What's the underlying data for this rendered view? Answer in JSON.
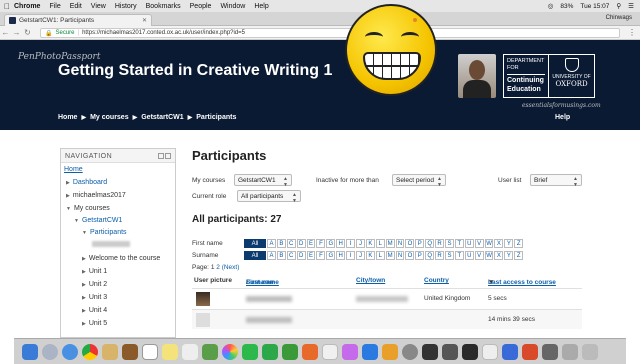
{
  "menubar": {
    "app": "Chrome",
    "items": [
      "File",
      "Edit",
      "View",
      "History",
      "Bookmarks",
      "People",
      "Window",
      "Help"
    ],
    "battery": "83%",
    "clock": "Tue 15:07"
  },
  "browser": {
    "tab_title": "GetstartCW1: Participants",
    "profile": "Chinwags",
    "secure_label": "Secure",
    "url": "https://michaelmas2017.conted.ox.ac.uk/user/index.php?id=5"
  },
  "header": {
    "watermark_top": "PenPhotoPassport",
    "course_title": "Getting Started in Creative Writing 1",
    "dept_logo": [
      "DEPARTMENT FOR",
      "Continuing",
      "Education"
    ],
    "oxford_logo": [
      "UNIVERSITY OF",
      "OXFORD"
    ],
    "watermark_bottom": "essentialsformusings.com",
    "breadcrumb": [
      "Home",
      "My courses",
      "GetstartCW1",
      "Participants"
    ],
    "help": "Help"
  },
  "navigation": {
    "title": "NAVIGATION",
    "home": "Home",
    "dashboard": "Dashboard",
    "michaelmas": "michaelmas2017",
    "my_courses": "My courses",
    "course": "GetstartCW1",
    "participants": "Participants",
    "welcome": "Welcome to the course",
    "units": [
      "Unit 1",
      "Unit 2",
      "Unit 3",
      "Unit 4",
      "Unit 5"
    ]
  },
  "main": {
    "title": "Participants",
    "my_courses_label": "My courses",
    "my_courses_value": "GetstartCW1",
    "inactive_label": "Inactive for more than",
    "inactive_value": "Select period",
    "user_list_label": "User list",
    "user_list_value": "Brief",
    "current_role_label": "Current role",
    "current_role_value": "All participants",
    "all_participants": "All participants: 27",
    "first_name_label": "First name",
    "surname_label": "Surname",
    "all_label": "All",
    "letters": [
      "A",
      "B",
      "C",
      "D",
      "E",
      "F",
      "G",
      "H",
      "I",
      "J",
      "K",
      "L",
      "M",
      "N",
      "O",
      "P",
      "Q",
      "R",
      "S",
      "T",
      "U",
      "V",
      "W",
      "X",
      "Y",
      "Z"
    ],
    "page_prefix": "Page:",
    "page_current": "1",
    "page_2": "2",
    "page_next": "(Next)"
  },
  "table": {
    "col_picture": "User picture",
    "col_first": "First name",
    "col_sep": " / ",
    "col_surname": "Surname",
    "col_city": "City/town",
    "col_country": "Country",
    "col_last": "Last access to course",
    "rows": [
      {
        "country": "United Kingdom",
        "last": "5 secs"
      },
      {
        "country": "",
        "last": "14 mins 39 secs"
      }
    ]
  }
}
